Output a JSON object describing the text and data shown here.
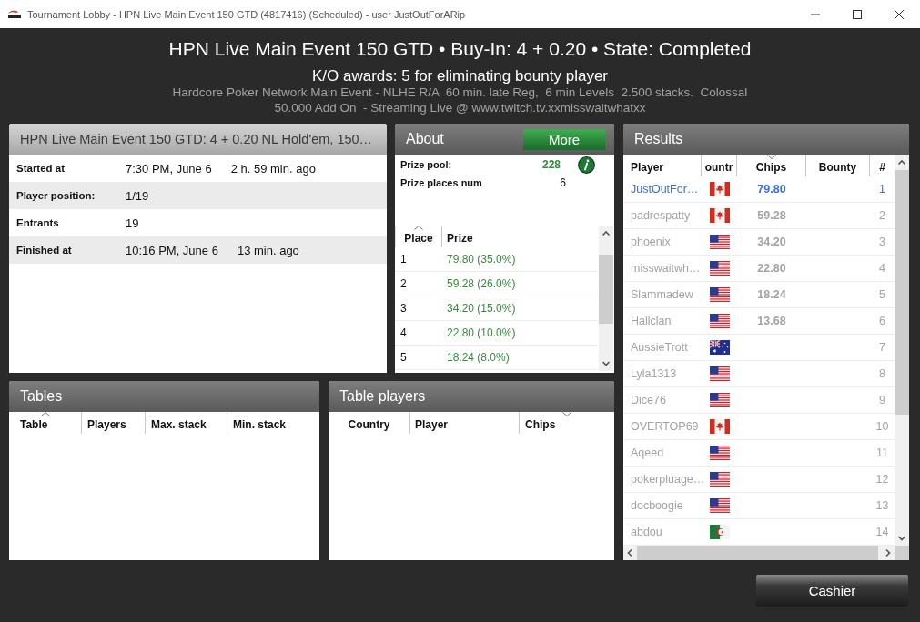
{
  "window": {
    "title": "Tournament Lobby - HPN Live Main Event 150 GTD (4817416) (Scheduled) - user JustOutForARip"
  },
  "header": {
    "title": "HPN Live Main Event 150 GTD • Buy-In: 4 + 0.20 • State: Completed",
    "ko_awards": "K/O awards: 5 for eliminating bounty player",
    "description": "Hardcore Poker Network Main Event - NLHE R/A  60 min. late Reg,  6 min Levels  2.500 stacks.  Colossal 50.000 Add On  - Streaming Live @ www.twitch.tv.xxmisswaitwhatxx"
  },
  "info": {
    "title": "HPN Live Main Event 150 GTD: 4 + 0.20 NL Hold'em, 150…",
    "rows": [
      {
        "label": "Started at",
        "value": "7:30 PM, June 6",
        "ago": "2 h. 59 min. ago"
      },
      {
        "label": "Player position:",
        "value": "1/19"
      },
      {
        "label": "Entrants",
        "value": "19"
      },
      {
        "label": "Finished at",
        "value": "10:16 PM, June 6",
        "ago": "13 min. ago"
      }
    ]
  },
  "about": {
    "title": "About",
    "more_button": "More",
    "prize_pool": {
      "label": "Prize pool:",
      "value": "228"
    },
    "prize_places": {
      "label": "Prize places num",
      "value": "6"
    },
    "prize_table": {
      "columns": [
        {
          "label": "Place",
          "sorted": true,
          "descending": false
        },
        {
          "label": "Prize",
          "sorted": false
        }
      ],
      "rows": [
        {
          "place": "1",
          "prize": "79.80 (35.0%)"
        },
        {
          "place": "2",
          "prize": "59.28 (26.0%)"
        },
        {
          "place": "3",
          "prize": "34.20 (15.0%)"
        },
        {
          "place": "4",
          "prize": "22.80 (10.0%)"
        },
        {
          "place": "5",
          "prize": "18.24 (8.0%)"
        }
      ]
    }
  },
  "results": {
    "title": "Results",
    "columns": [
      {
        "label": "Player",
        "sorted": false
      },
      {
        "label": "ountr",
        "sorted": false
      },
      {
        "label": "Chips",
        "sorted": true,
        "descending": true
      },
      {
        "label": "Bounty",
        "sorted": false
      },
      {
        "label": "#",
        "sorted": false
      }
    ],
    "rows": [
      {
        "player": "JustOutFor…",
        "kind": "canada",
        "chips": "79.80",
        "rank": "1",
        "current_user": true
      },
      {
        "player": "padrespatty",
        "kind": "canada",
        "chips": "59.28",
        "rank": "2",
        "current_user": false
      },
      {
        "player": "phoenix",
        "kind": "usa",
        "chips": "34.20",
        "rank": "3",
        "current_user": false
      },
      {
        "player": "misswaitwh…",
        "kind": "usa",
        "chips": "22.80",
        "rank": "4",
        "current_user": false
      },
      {
        "player": "Slammadew",
        "kind": "usa",
        "chips": "18.24",
        "rank": "5",
        "current_user": false
      },
      {
        "player": "Hallclan",
        "kind": "usa",
        "chips": "13.68",
        "rank": "6",
        "current_user": false
      },
      {
        "player": "AussieTrott",
        "kind": "australia",
        "rank": "7",
        "current_user": false
      },
      {
        "player": "Lyla1313",
        "kind": "usa",
        "rank": "8",
        "current_user": false
      },
      {
        "player": "Dice76",
        "kind": "usa",
        "rank": "9",
        "current_user": false
      },
      {
        "player": "OVERTOP69",
        "kind": "canada",
        "rank": "10",
        "current_user": false
      },
      {
        "player": "Aqeed",
        "kind": "usa",
        "rank": "11",
        "current_user": false
      },
      {
        "player": "pokerpluage…",
        "kind": "usa",
        "rank": "12",
        "current_user": false
      },
      {
        "player": "docboogie",
        "kind": "usa",
        "rank": "13",
        "current_user": false
      },
      {
        "player": "abdou",
        "kind": "algeria",
        "rank": "14",
        "current_user": false
      }
    ]
  },
  "tables": {
    "title": "Tables",
    "columns": [
      {
        "label": "Table",
        "sorted": true,
        "descending": false
      },
      {
        "label": "Players",
        "sorted": false
      },
      {
        "label": "Max. stack",
        "sorted": false
      },
      {
        "label": "Min. stack",
        "sorted": false
      }
    ]
  },
  "table_players": {
    "title": "Table players",
    "columns": [
      {
        "label": "Country",
        "sorted": false
      },
      {
        "label": "Player",
        "sorted": false
      },
      {
        "label": "Chips",
        "sorted": true,
        "descending": true
      }
    ]
  },
  "cashier_button": "Cashier"
}
